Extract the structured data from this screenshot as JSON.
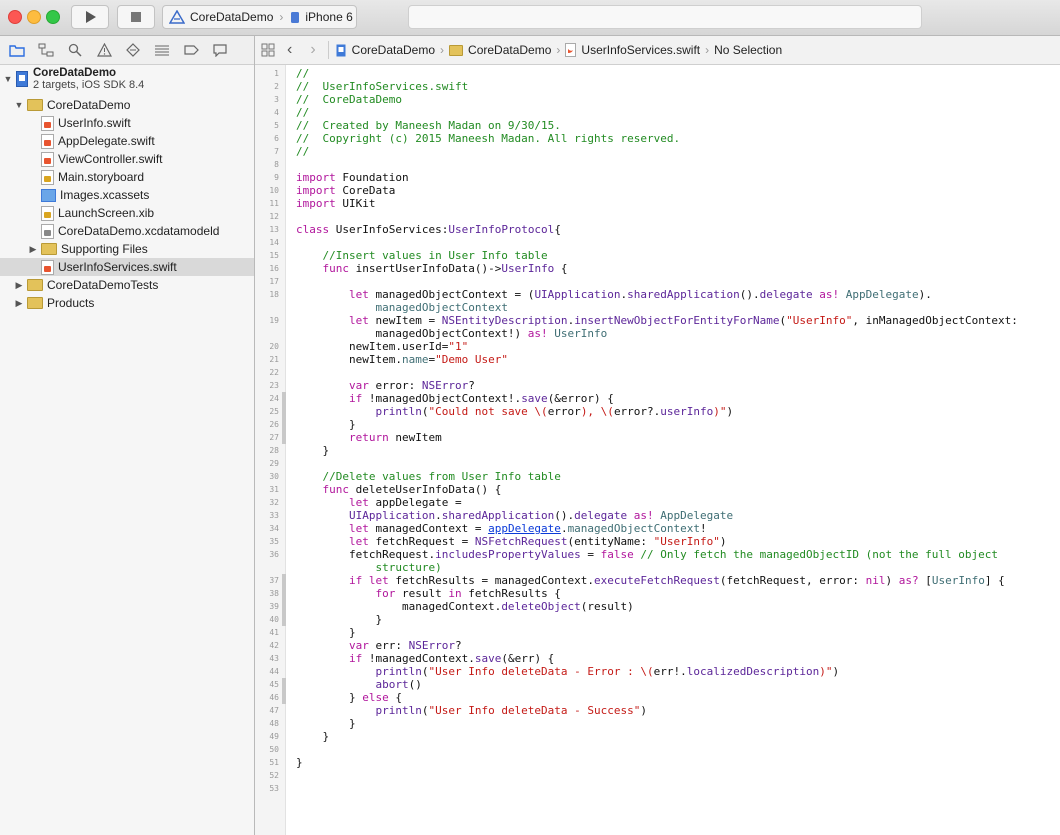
{
  "toolbar": {
    "scheme_project": "CoreDataDemo",
    "scheme_device": "iPhone 6",
    "run_icon": "play-icon",
    "stop_icon": "stop-icon"
  },
  "navigator": {
    "icons": [
      "folder-icon",
      "symbol-icon",
      "search-icon",
      "warning-icon",
      "test-icon",
      "debug-icon",
      "breakpoint-icon",
      "log-icon"
    ],
    "project_name": "CoreDataDemo",
    "project_subtitle": "2 targets, iOS SDK 8.4",
    "items": [
      {
        "label": "CoreDataDemo",
        "kind": "group",
        "indent": 1,
        "expanded": true
      },
      {
        "label": "UserInfo.swift",
        "kind": "swift",
        "indent": 2
      },
      {
        "label": "AppDelegate.swift",
        "kind": "swift",
        "indent": 2
      },
      {
        "label": "ViewController.swift",
        "kind": "swift",
        "indent": 2
      },
      {
        "label": "Main.storyboard",
        "kind": "storyboard",
        "indent": 2
      },
      {
        "label": "Images.xcassets",
        "kind": "assets",
        "indent": 2
      },
      {
        "label": "LaunchScreen.xib",
        "kind": "xib",
        "indent": 2
      },
      {
        "label": "CoreDataDemo.xcdatamodeld",
        "kind": "datamodel",
        "indent": 2
      },
      {
        "label": "Supporting Files",
        "kind": "group",
        "indent": 2,
        "expanded": false
      },
      {
        "label": "UserInfoServices.swift",
        "kind": "swift",
        "indent": 2,
        "selected": true
      },
      {
        "label": "CoreDataDemoTests",
        "kind": "group",
        "indent": 1,
        "expanded": false
      },
      {
        "label": "Products",
        "kind": "group",
        "indent": 1,
        "expanded": false
      }
    ]
  },
  "jumpbar": {
    "crumbs": [
      "CoreDataDemo",
      "CoreDataDemo",
      "UserInfoServices.swift",
      "No Selection"
    ]
  },
  "editor": {
    "lines": [
      {
        "n": "1",
        "html": "<span class='c'>//</span>"
      },
      {
        "n": "2",
        "html": "<span class='c'>//  UserInfoServices.swift</span>"
      },
      {
        "n": "3",
        "html": "<span class='c'>//  CoreDataDemo</span>"
      },
      {
        "n": "4",
        "html": "<span class='c'>//</span>"
      },
      {
        "n": "5",
        "html": "<span class='c'>//  Created by Maneesh Madan on 9/30/15.</span>"
      },
      {
        "n": "6",
        "html": "<span class='c'>//  Copyright (c) 2015 Maneesh Madan. All rights reserved.</span>"
      },
      {
        "n": "7",
        "html": "<span class='c'>//</span>"
      },
      {
        "n": "8",
        "html": ""
      },
      {
        "n": "9",
        "html": "<span class='k'>import</span> Foundation"
      },
      {
        "n": "10",
        "html": "<span class='k'>import</span> CoreData"
      },
      {
        "n": "11",
        "html": "<span class='k'>import</span> UIKit"
      },
      {
        "n": "12",
        "html": ""
      },
      {
        "n": "13",
        "html": "<span class='k'>class</span> UserInfoServices:<span class='t'>UserInfoProtocol</span>{"
      },
      {
        "n": "14",
        "html": ""
      },
      {
        "n": "15",
        "html": "    <span class='c'>//Insert values in User Info table</span>"
      },
      {
        "n": "16",
        "html": "    <span class='k'>func</span> insertUserInfoData()-><span class='t'>UserInfo</span> {"
      },
      {
        "n": "17",
        "html": ""
      },
      {
        "n": "18",
        "html": "        <span class='k'>let</span> managedObjectContext = (<span class='t'>UIApplication</span>.<span class='t'>sharedApplication</span>().<span class='t'>delegate</span> <span class='k'>as!</span> <span class='m'>AppDelegate</span>)."
      },
      {
        "n": "",
        "html": "            <span class='m'>managedObjectContext</span>"
      },
      {
        "n": "19",
        "html": "        <span class='k'>let</span> newItem = <span class='t'>NSEntityDescription</span>.<span class='t'>insertNewObjectForEntityForName</span>(<span class='s'>\"UserInfo\"</span>, inManagedObjectContext:"
      },
      {
        "n": "",
        "html": "            managedObjectContext!) <span class='k'>as!</span> <span class='m'>UserInfo</span>"
      },
      {
        "n": "20",
        "html": "        newItem.userId=<span class='s'>\"1\"</span>"
      },
      {
        "n": "21",
        "html": "        newItem.<span class='m'>name</span>=<span class='s'>\"Demo User\"</span>"
      },
      {
        "n": "22",
        "html": ""
      },
      {
        "n": "23",
        "html": "        <span class='k'>var</span> error: <span class='t'>NSError</span>?"
      },
      {
        "n": "24",
        "html": "        <span class='k'>if</span> !managedObjectContext!.<span class='t'>save</span>(&amp;error) {"
      },
      {
        "n": "25",
        "html": "            <span class='t'>println</span>(<span class='s'>\"Could not save \\(</span>error<span class='s'>), \\(</span>error?.<span class='t'>userInfo</span><span class='s'>)\"</span>)"
      },
      {
        "n": "26",
        "html": "        }"
      },
      {
        "n": "27",
        "html": "        <span class='k'>return</span> newItem"
      },
      {
        "n": "28",
        "html": "    }"
      },
      {
        "n": "29",
        "html": ""
      },
      {
        "n": "30",
        "html": "    <span class='c'>//Delete values from User Info table</span>"
      },
      {
        "n": "31",
        "html": "    <span class='k'>func</span> deleteUserInfoData() {"
      },
      {
        "n": "32",
        "html": "        <span class='k'>let</span> appDelegate ="
      },
      {
        "n": "33",
        "html": "        <span class='t'>UIApplication</span>.<span class='t'>sharedApplication</span>().<span class='t'>delegate</span> <span class='k'>as!</span> <span class='m'>AppDelegate</span>"
      },
      {
        "n": "34",
        "html": "        <span class='k'>let</span> managedContext = <span class='u'>appDelegate</span>.<span class='m'>managedObjectContext</span>!"
      },
      {
        "n": "35",
        "html": "        <span class='k'>let</span> fetchRequest = <span class='t'>NSFetchRequest</span>(entityName: <span class='s'>\"UserInfo\"</span>)"
      },
      {
        "n": "36",
        "html": "        fetchRequest.<span class='t'>includesPropertyValues</span> = <span class='k'>false</span> <span class='c'>// Only fetch the managedObjectID (not the full object</span>"
      },
      {
        "n": "",
        "html": "            <span class='c'>structure)</span>"
      },
      {
        "n": "37",
        "html": "        <span class='k'>if let</span> fetchResults = managedContext.<span class='t'>executeFetchRequest</span>(fetchRequest, error: <span class='k'>nil</span>) <span class='k'>as?</span> [<span class='m'>UserInfo</span>] {"
      },
      {
        "n": "38",
        "html": "            <span class='k'>for</span> result <span class='k'>in</span> fetchResults {"
      },
      {
        "n": "39",
        "html": "                managedContext.<span class='t'>deleteObject</span>(result)"
      },
      {
        "n": "40",
        "html": "            }"
      },
      {
        "n": "41",
        "html": "        }"
      },
      {
        "n": "42",
        "html": "        <span class='k'>var</span> err: <span class='t'>NSError</span>?"
      },
      {
        "n": "43",
        "html": "        <span class='k'>if</span> !managedContext.<span class='t'>save</span>(&amp;err) {"
      },
      {
        "n": "44",
        "html": "            <span class='t'>println</span>(<span class='s'>\"User Info deleteData - Error : \\(</span>err!.<span class='t'>localizedDescription</span><span class='s'>)\"</span>)"
      },
      {
        "n": "45",
        "html": "            <span class='t'>abort</span>()"
      },
      {
        "n": "46",
        "html": "        } <span class='k'>else</span> {"
      },
      {
        "n": "47",
        "html": "            <span class='t'>println</span>(<span class='s'>\"User Info deleteData - Success\"</span>)"
      },
      {
        "n": "48",
        "html": "        }"
      },
      {
        "n": "49",
        "html": "    }"
      },
      {
        "n": "50",
        "html": ""
      },
      {
        "n": "51",
        "html": "}"
      },
      {
        "n": "52",
        "html": ""
      },
      {
        "n": "53",
        "html": ""
      }
    ]
  },
  "colors": {
    "keyword": "#b1169c",
    "comment": "#228b22",
    "string": "#c41a16",
    "type": "#5c2699",
    "member": "#3f6e74"
  }
}
